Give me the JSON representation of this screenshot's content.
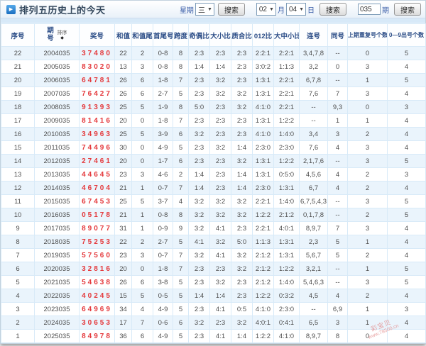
{
  "header": {
    "title": "排列五历史上的今天",
    "week_label": "星期",
    "week_value": "三",
    "search_label": "搜索",
    "month_value": "02",
    "month_label": "月",
    "day_value": "04",
    "day_label": "日",
    "issue_value": "035",
    "issue_label": "期"
  },
  "table": {
    "sort_label": "排序",
    "sort_icon": "diamond-sort-icon",
    "columns": [
      "序号",
      "期号",
      "奖号",
      "和值",
      "和值尾",
      "首尾号",
      "跨度",
      "奇偶比",
      "大小比",
      "质合比",
      "012比",
      "大中小比",
      "连号",
      "同号",
      "上期重复号个数",
      "0—9出号个数"
    ],
    "rows": [
      [
        "22",
        "2004035",
        "37480",
        "22",
        "2",
        "0-8",
        "8",
        "2:3",
        "2:3",
        "2:3",
        "2:2:1",
        "2:2:1",
        "3,4,7,8",
        "--",
        "0",
        "5"
      ],
      [
        "21",
        "2005035",
        "83020",
        "13",
        "3",
        "0-8",
        "8",
        "1:4",
        "1:4",
        "2:3",
        "3:0:2",
        "1:1:3",
        "3,2",
        "0",
        "3",
        "4"
      ],
      [
        "20",
        "2006035",
        "64781",
        "26",
        "6",
        "1-8",
        "7",
        "2:3",
        "3:2",
        "2:3",
        "1:3:1",
        "2:2:1",
        "6,7,8",
        "--",
        "1",
        "5"
      ],
      [
        "19",
        "2007035",
        "76427",
        "26",
        "6",
        "2-7",
        "5",
        "2:3",
        "3:2",
        "3:2",
        "1:3:1",
        "2:2:1",
        "7,6",
        "7",
        "3",
        "4"
      ],
      [
        "18",
        "2008035",
        "91393",
        "25",
        "5",
        "1-9",
        "8",
        "5:0",
        "2:3",
        "3:2",
        "4:1:0",
        "2:2:1",
        "--",
        "9,3",
        "0",
        "3"
      ],
      [
        "17",
        "2009035",
        "81416",
        "20",
        "0",
        "1-8",
        "7",
        "2:3",
        "2:3",
        "2:3",
        "1:3:1",
        "1:2:2",
        "--",
        "1",
        "1",
        "4"
      ],
      [
        "16",
        "2010035",
        "34963",
        "25",
        "5",
        "3-9",
        "6",
        "3:2",
        "2:3",
        "2:3",
        "4:1:0",
        "1:4:0",
        "3,4",
        "3",
        "2",
        "4"
      ],
      [
        "15",
        "2011035",
        "74496",
        "30",
        "0",
        "4-9",
        "5",
        "2:3",
        "3:2",
        "1:4",
        "2:3:0",
        "2:3:0",
        "7,6",
        "4",
        "3",
        "4"
      ],
      [
        "14",
        "2012035",
        "27461",
        "20",
        "0",
        "1-7",
        "6",
        "2:3",
        "2:3",
        "3:2",
        "1:3:1",
        "1:2:2",
        "2,1,7,6",
        "--",
        "3",
        "5"
      ],
      [
        "13",
        "2013035",
        "44645",
        "23",
        "3",
        "4-6",
        "2",
        "1:4",
        "2:3",
        "1:4",
        "1:3:1",
        "0:5:0",
        "4,5,6",
        "4",
        "2",
        "3"
      ],
      [
        "12",
        "2014035",
        "46704",
        "21",
        "1",
        "0-7",
        "7",
        "1:4",
        "2:3",
        "1:4",
        "2:3:0",
        "1:3:1",
        "6,7",
        "4",
        "2",
        "4"
      ],
      [
        "11",
        "2015035",
        "67453",
        "25",
        "5",
        "3-7",
        "4",
        "3:2",
        "3:2",
        "3:2",
        "2:2:1",
        "1:4:0",
        "6,7,5,4,3",
        "--",
        "3",
        "5"
      ],
      [
        "10",
        "2016035",
        "05178",
        "21",
        "1",
        "0-8",
        "8",
        "3:2",
        "3:2",
        "3:2",
        "1:2:2",
        "2:1:2",
        "0,1,7,8",
        "--",
        "2",
        "5"
      ],
      [
        "9",
        "2017035",
        "89077",
        "31",
        "1",
        "0-9",
        "9",
        "3:2",
        "4:1",
        "2:3",
        "2:2:1",
        "4:0:1",
        "8,9,7",
        "7",
        "3",
        "4"
      ],
      [
        "8",
        "2018035",
        "75253",
        "22",
        "2",
        "2-7",
        "5",
        "4:1",
        "3:2",
        "5:0",
        "1:1:3",
        "1:3:1",
        "2,3",
        "5",
        "1",
        "4"
      ],
      [
        "7",
        "2019035",
        "57560",
        "23",
        "3",
        "0-7",
        "7",
        "3:2",
        "4:1",
        "3:2",
        "2:1:2",
        "1:3:1",
        "5,6,7",
        "5",
        "2",
        "4"
      ],
      [
        "6",
        "2020035",
        "32816",
        "20",
        "0",
        "1-8",
        "7",
        "2:3",
        "2:3",
        "3:2",
        "2:1:2",
        "1:2:2",
        "3,2,1",
        "--",
        "1",
        "5"
      ],
      [
        "5",
        "2021035",
        "54638",
        "26",
        "6",
        "3-8",
        "5",
        "2:3",
        "3:2",
        "2:3",
        "2:1:2",
        "1:4:0",
        "5,4,6,3",
        "--",
        "3",
        "5"
      ],
      [
        "4",
        "2022035",
        "40245",
        "15",
        "5",
        "0-5",
        "5",
        "1:4",
        "1:4",
        "2:3",
        "1:2:2",
        "0:3:2",
        "4,5",
        "4",
        "2",
        "4"
      ],
      [
        "3",
        "2023035",
        "64969",
        "34",
        "4",
        "4-9",
        "5",
        "2:3",
        "4:1",
        "0:5",
        "4:1:0",
        "2:3:0",
        "--",
        "6,9",
        "1",
        "3"
      ],
      [
        "2",
        "2024035",
        "30653",
        "17",
        "7",
        "0-6",
        "6",
        "3:2",
        "2:3",
        "3:2",
        "4:0:1",
        "0:4:1",
        "6,5",
        "3",
        "1",
        "4"
      ],
      [
        "1",
        "2025035",
        "84978",
        "36",
        "6",
        "4-9",
        "5",
        "2:3",
        "4:1",
        "1:4",
        "1:2:2",
        "4:1:0",
        "8,9,7",
        "8",
        "0",
        "4"
      ]
    ]
  },
  "watermark": {
    "line1": "彩宝贝",
    "line2": "www.78500.cn"
  }
}
